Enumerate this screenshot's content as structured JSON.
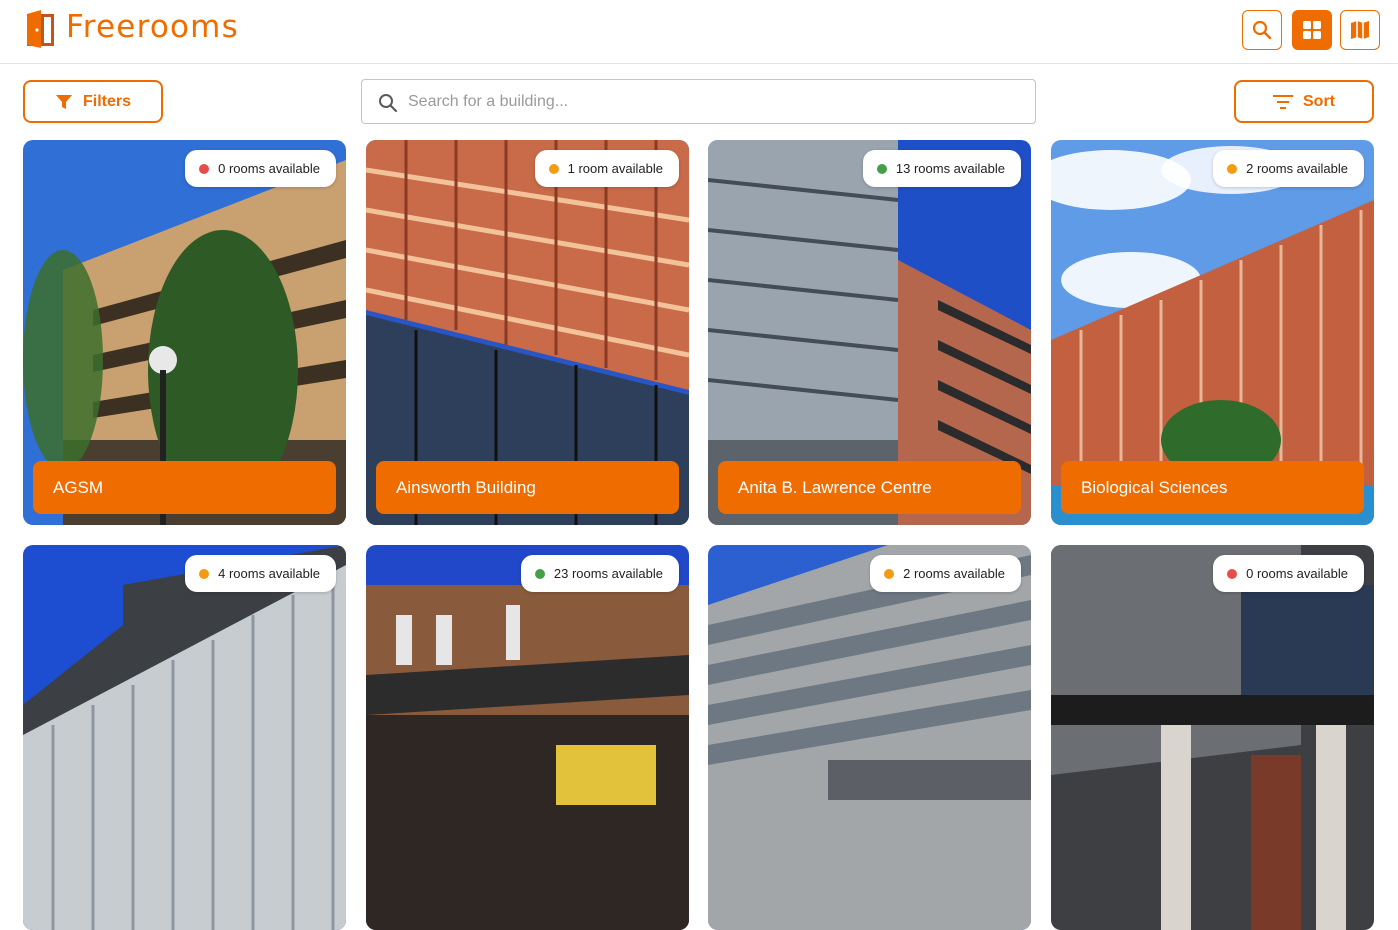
{
  "app": {
    "brand": "Freerooms"
  },
  "header": {
    "search_icon": "search-icon",
    "grid_icon": "grid-view-icon",
    "map_icon": "map-icon",
    "accent": "#ef6c00"
  },
  "toolbar": {
    "filters_label": "Filters",
    "sort_label": "Sort",
    "search_placeholder": "Search for a building...",
    "search_value": ""
  },
  "status_colors": {
    "red": "#e94b4b",
    "orange": "#f39c12",
    "green": "#43a047"
  },
  "buildings": [
    {
      "name": "AGSM",
      "availability": "0 rooms available",
      "status": "red"
    },
    {
      "name": "Ainsworth Building",
      "availability": "1 room available",
      "status": "orange"
    },
    {
      "name": "Anita B. Lawrence Centre",
      "availability": "13 rooms available",
      "status": "green"
    },
    {
      "name": "Biological Sciences",
      "availability": "2 rooms available",
      "status": "orange"
    },
    {
      "name": "",
      "availability": "4 rooms available",
      "status": "orange"
    },
    {
      "name": "",
      "availability": "23 rooms available",
      "status": "green"
    },
    {
      "name": "",
      "availability": "2 rooms available",
      "status": "orange"
    },
    {
      "name": "",
      "availability": "0 rooms available",
      "status": "red"
    }
  ]
}
